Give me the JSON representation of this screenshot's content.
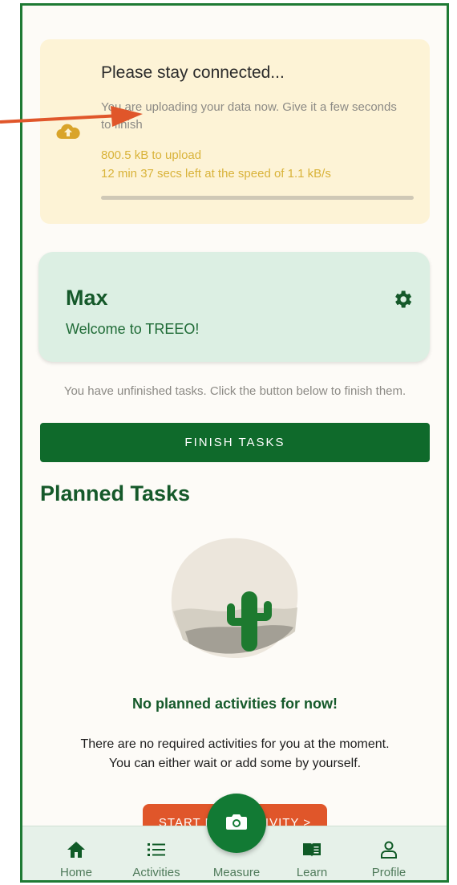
{
  "upload": {
    "title": "Please stay connected...",
    "description": "You are uploading your data now. Give it a few seconds to finish",
    "size_text": "800.5 kB to upload",
    "time_text": "12 min 37 secs left at the speed of 1.1 kB/s",
    "progress_percent": 0,
    "icon": "cloud-upload-icon"
  },
  "profile": {
    "name": "Max",
    "welcome": "Welcome to TREEO!",
    "settings_icon": "gear-icon"
  },
  "tasks": {
    "unfinished_text": "You have unfinished tasks. Click the button below to finish them.",
    "finish_button": "FINISH TASKS"
  },
  "planned": {
    "title": "Planned Tasks",
    "empty_title": "No planned activities for now!",
    "empty_description": "There are no required activities for you at the moment. You can either wait or add some by yourself.",
    "start_button": "START NEW ACTIVITY  >"
  },
  "nav": {
    "items": [
      {
        "label": "Home",
        "icon": "home-icon"
      },
      {
        "label": "Activities",
        "icon": "list-icon"
      },
      {
        "label": "Measure",
        "icon": "camera-icon"
      },
      {
        "label": "Learn",
        "icon": "book-icon"
      },
      {
        "label": "Profile",
        "icon": "user-icon"
      }
    ]
  },
  "colors": {
    "brand_green": "#0f6a2b",
    "accent_orange": "#e0562a",
    "upload_bg": "#fdf3d6",
    "profile_bg": "#dcefe3",
    "annotation_arrow": "#e0562a"
  }
}
